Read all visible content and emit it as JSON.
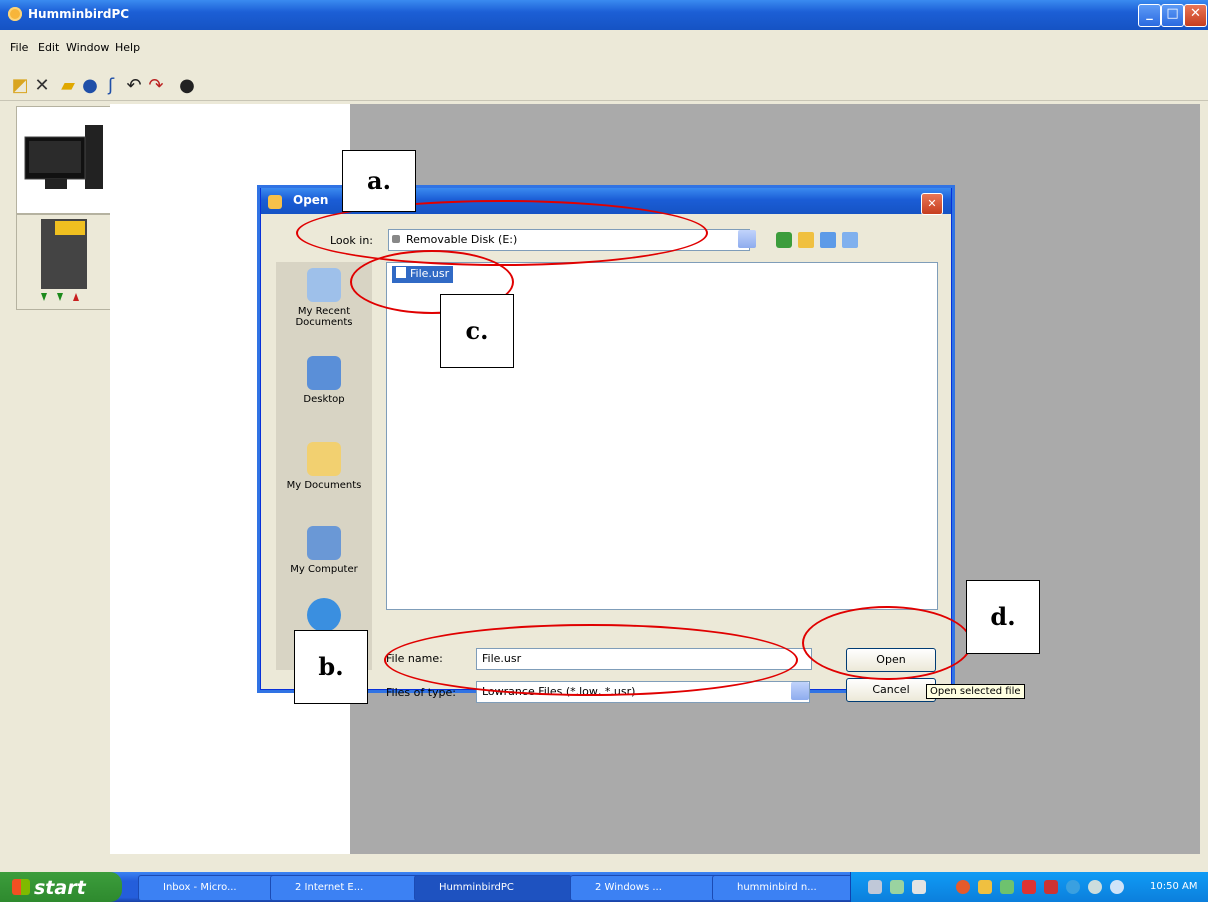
{
  "window": {
    "title": "HumminbirdPC"
  },
  "menu": [
    "File",
    "Edit",
    "Window",
    "Help"
  ],
  "dialog": {
    "title": "Open",
    "look_in_label": "Look in:",
    "look_in_value": "Removable Disk (E:)",
    "file_name_label": "File name:",
    "file_name_value": "File.usr",
    "files_of_type_label": "Files of type:",
    "files_of_type_value": "Lowrance Files (*.low, *.usr)",
    "open_label": "Open",
    "cancel_label": "Cancel",
    "open_tooltip": "Open selected file",
    "files": [
      "File.usr"
    ],
    "places": [
      "My Recent\nDocuments",
      "Desktop",
      "My Documents",
      "My Computer",
      ""
    ]
  },
  "annotations": {
    "a": "a.",
    "b": "b.",
    "c": "c.",
    "d": "d."
  },
  "taskbar": {
    "start_label": "start",
    "tasks": [
      "Inbox - Micro...",
      "2 Internet E...",
      "HumminbirdPC",
      "2 Windows ...",
      "humminbird n..."
    ],
    "clock": "10:50 AM"
  },
  "colors": {
    "annotation_red": "#e00000",
    "titlebar_blue": "#1c5fd6",
    "selection_blue": "#316ac5"
  }
}
